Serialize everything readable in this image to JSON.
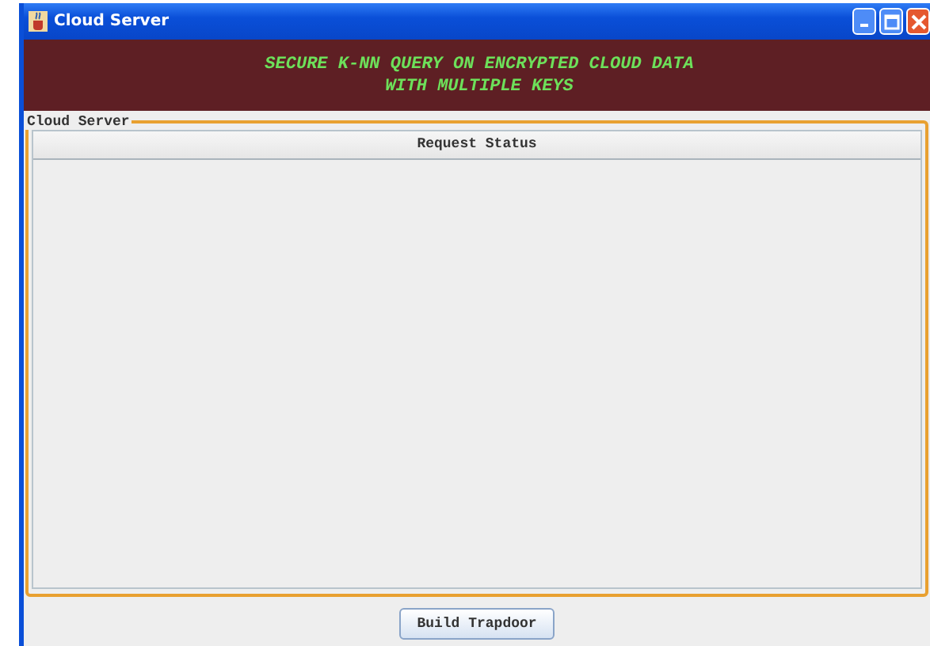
{
  "window": {
    "title": "Cloud Server"
  },
  "banner": {
    "lines": [
      "SECURE K-NN QUERY ON ENCRYPTED CLOUD DATA",
      "WITH MULTIPLE KEYS"
    ]
  },
  "panel": {
    "title": "Cloud Server",
    "table": {
      "columns": [
        "Request Status"
      ]
    }
  },
  "buttons": [
    "Build Trapdoor"
  ]
}
